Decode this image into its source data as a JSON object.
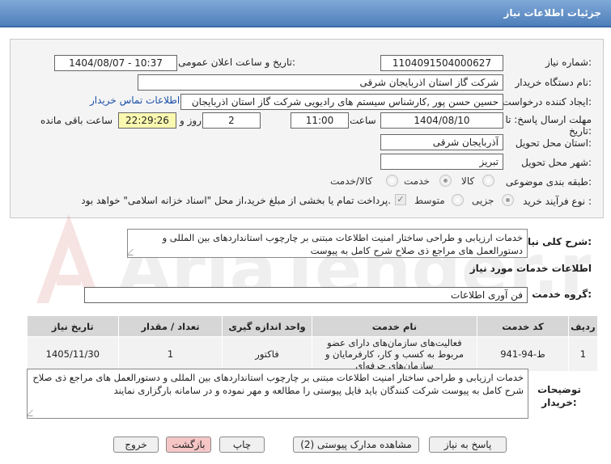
{
  "header": {
    "title": "جزئیات اطلاعات نیاز"
  },
  "form": {
    "need_number": {
      "label": "شماره نیاز:",
      "value": "1104091504000627"
    },
    "announce": {
      "label": "تاریخ و ساعت اعلان عمومی:",
      "value": "1404/08/07 - 10:37"
    },
    "buyer": {
      "label": "نام دستگاه خریدار:",
      "value": "شرکت گاز استان اذربایجان شرقی"
    },
    "creator": {
      "label": "ایجاد کننده درخواست:",
      "value": "حسین حسن پور ,کارشناس سیستم های رادیویی  شرکت گاز استان اذربایجان",
      "contact_link": "اطلاعات تماس خریدار"
    },
    "deadline": {
      "label": "مهلت ارسال پاسخ: تا تاریخ:",
      "date": "1404/08/10",
      "time_label": "ساعت",
      "time": "11:00",
      "days": "2",
      "days_label": "روز و",
      "remaining": "22:29:26",
      "remaining_label": "ساعت باقی مانده"
    },
    "province": {
      "label": "استان محل تحویل:",
      "value": "آذربایجان شرقی"
    },
    "city": {
      "label": "شهر محل تحویل:",
      "value": "تبریز"
    },
    "category": {
      "label": "طبقه بندی موضوعی:",
      "options": [
        "کالا",
        "خدمت",
        "کالا/خدمت"
      ],
      "selected": "خدمت"
    },
    "process": {
      "label": "نوع فرآیند خرید :",
      "options": [
        "جزیی",
        "متوسط"
      ],
      "selected": "جزیی",
      "payment_note": "پرداخت تمام یا بخشی از مبلغ خرید،از محل \"اسناد خزانه اسلامی\" خواهد بود."
    }
  },
  "summary": {
    "label": "شرح کلی نیاز:",
    "text": "خدمات ارزیابی و طراحی ساختار امنیت اطلاعات مبتنی بر چارچوب استانداردهای بین المللی و دستورالعمل های مراجع ذی صلاح شرح کامل به پیوست"
  },
  "services": {
    "heading": "اطلاعات خدمات مورد نیاز",
    "group_label": "گروه خدمت:",
    "group_value": "فن آوری اطلاعات",
    "columns": [
      "ردیف",
      "کد خدمت",
      "نام خدمت",
      "واحد اندازه گیری",
      "تعداد / مقدار",
      "تاریخ نیاز"
    ],
    "rows": [
      {
        "row": "1",
        "code": "ط-94-941",
        "name": "فعالیت‌های سازمان‌های دارای عضو مربوط به کسب و کار، کارفرمایان و سازمان‌های حرفه‌ای",
        "unit": "فاکتور",
        "qty": "1",
        "date": "1405/11/30"
      }
    ]
  },
  "buyer_notes": {
    "label": "توضیحات خریدار:",
    "text": "خدمات ارزیابی و طراحی ساختار امنیت اطلاعات مبتنی بر چارچوب استانداردهای بین المللی و دستورالعمل های مراجع ذی صلاح شرح کامل به پیوست شرکت کنندگان باید فایل پیوستی را مطالعه و مهر نموده و در سامانه بارگزاری نمایند"
  },
  "buttons": {
    "reply": "پاسخ به نیاز",
    "attachments": "مشاهده مدارک پیوستی (2)",
    "print": "چاپ",
    "back": "بازگشت",
    "exit": "خروج"
  },
  "watermark": {
    "text": "AriaTender.net"
  },
  "colors": {
    "header": "#5b88c2",
    "remaining_bg": "#fbf8b0",
    "exit_bg": "#f6c6c6",
    "link": "#1a4fa8"
  }
}
